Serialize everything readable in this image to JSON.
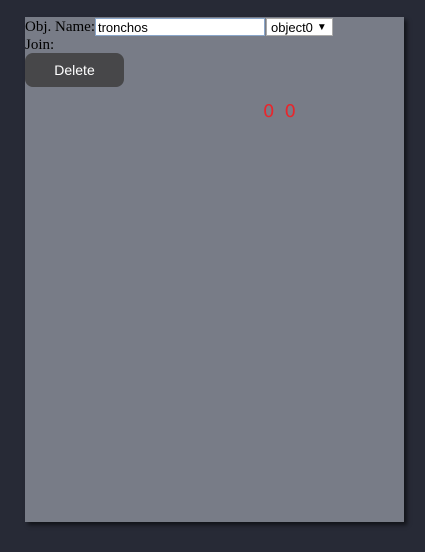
{
  "form": {
    "name_label": "Obj. Name:",
    "name_value": "tronchos",
    "select_value": "object0",
    "join_label": "Join:",
    "delete_label": "Delete"
  },
  "readout": {
    "x": "0",
    "y": "0"
  },
  "colors": {
    "background": "#272a36",
    "panel": "#787c87",
    "button": "#474749",
    "readout": "#e8262c"
  }
}
